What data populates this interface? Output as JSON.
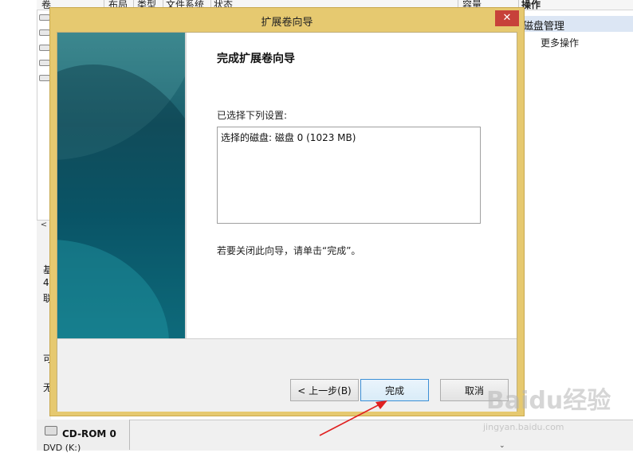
{
  "background": {
    "header_columns": [
      "卷",
      "布局",
      "类型",
      "文件系统",
      "状态",
      "容量"
    ],
    "action_header": "操作",
    "action_title": "磁盘管理",
    "action_more": "更多操作",
    "left_fragments": [
      "基",
      "4",
      "联",
      "可",
      "无"
    ],
    "cdrom_name": "CD-ROM 0",
    "cdrom_sub": "DVD (K:)"
  },
  "dialog": {
    "title": "扩展卷向导",
    "close_glyph": "✕",
    "page_title": "完成扩展卷向导",
    "selection_label": "已选择下列设置:",
    "selection_text": "选择的磁盘: 磁盘 0 (1023 MB)",
    "hint": "若要关闭此向导，请单击“完成”。",
    "buttons": {
      "back": "< 上一步(B)",
      "finish": "完成",
      "cancel": "取消"
    }
  },
  "watermark": {
    "text": "Baidu经验",
    "sub": "jingyan.baidu.com"
  },
  "colors": {
    "dialog_frame": "#e6c970",
    "close_button": "#c7413a",
    "annotation_arrow": "#e02020"
  }
}
